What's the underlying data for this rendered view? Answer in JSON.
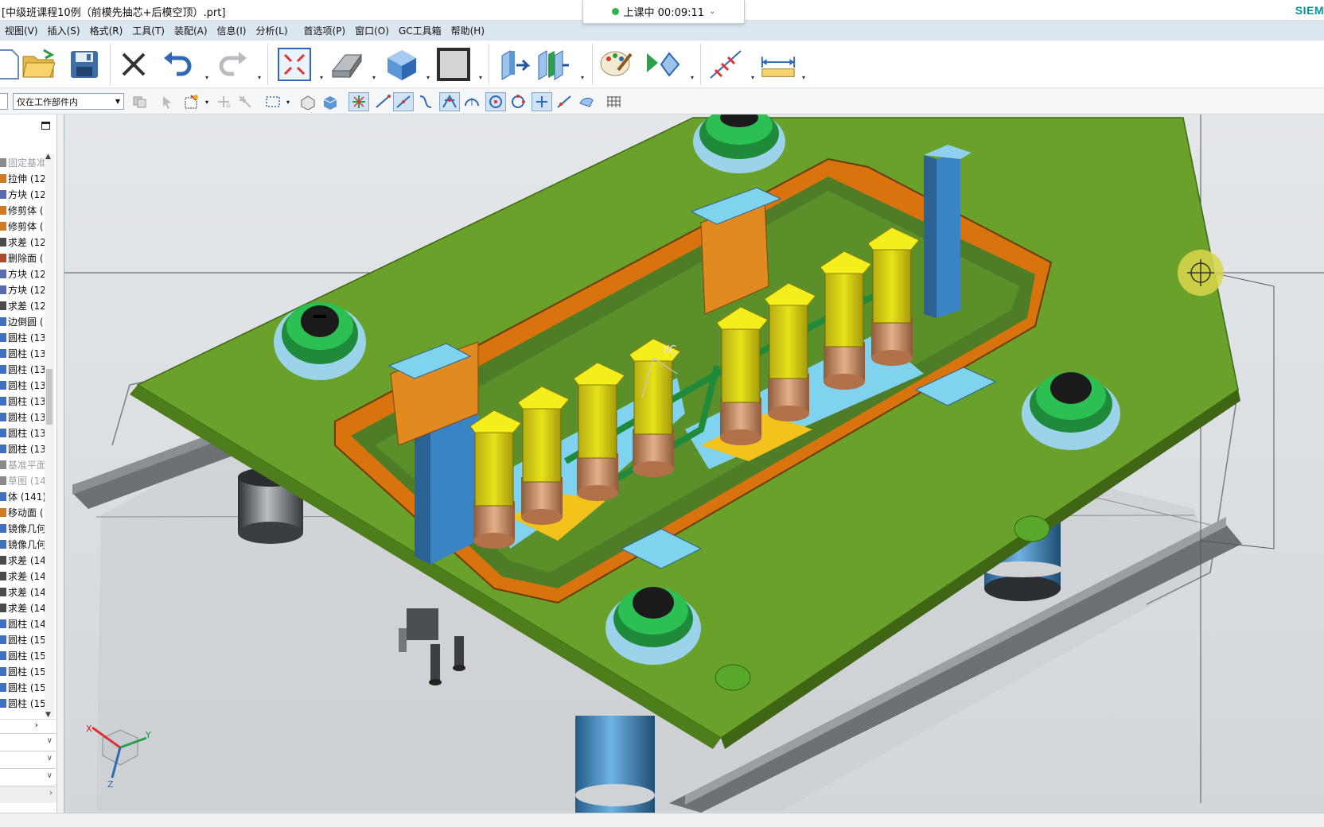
{
  "window": {
    "title": "[中级班课程10例（前模先抽芯+后模空顶）.prt]",
    "brand": "SIEM"
  },
  "timer": {
    "label": "上课中 00:09:11"
  },
  "menu": [
    "视图(V)",
    "插入(S)",
    "格式(R)",
    "工具(T)",
    "装配(A)",
    "信息(I)",
    "分析(L)",
    "首选项(P)",
    "窗口(O)",
    "GC工具箱",
    "帮助(H)"
  ],
  "selection_filter": {
    "value": "仅在工作部件内"
  },
  "navigator": {
    "items": [
      {
        "label": "固定基准",
        "dim": true,
        "color": "#8a8a8a"
      },
      {
        "label": "拉伸 (12",
        "color": "#d27a1e"
      },
      {
        "label": "方块 (12",
        "color": "#5a6ab0"
      },
      {
        "label": "修剪体 (",
        "color": "#d27a1e"
      },
      {
        "label": "修剪体 (",
        "color": "#d27a1e"
      },
      {
        "label": "求差 (12",
        "color": "#4a4a4a"
      },
      {
        "label": "删除面 (",
        "color": "#b04a2a"
      },
      {
        "label": "方块 (12",
        "color": "#5a6ab0"
      },
      {
        "label": "方块 (12",
        "color": "#5a6ab0"
      },
      {
        "label": "求差 (12",
        "color": "#4a4a4a"
      },
      {
        "label": "边倒圆 (",
        "color": "#3f6fbf"
      },
      {
        "label": "圆柱 (13",
        "color": "#3f6fbf"
      },
      {
        "label": "圆柱 (13",
        "color": "#3f6fbf"
      },
      {
        "label": "圆柱 (13",
        "color": "#3f6fbf"
      },
      {
        "label": "圆柱 (13",
        "color": "#3f6fbf"
      },
      {
        "label": "圆柱 (13",
        "color": "#3f6fbf"
      },
      {
        "label": "圆柱 (13",
        "color": "#3f6fbf"
      },
      {
        "label": "圆柱 (13",
        "color": "#3f6fbf"
      },
      {
        "label": "圆柱 (13",
        "color": "#3f6fbf"
      },
      {
        "label": "基准平面",
        "dim": true,
        "color": "#8a8a8a"
      },
      {
        "label": "草图 (14",
        "dim": true,
        "color": "#8a8a8a"
      },
      {
        "label": "体 (141)",
        "color": "#3f6fbf"
      },
      {
        "label": "移动面 (",
        "color": "#d27a1e"
      },
      {
        "label": "镜像几何",
        "color": "#3f6fbf"
      },
      {
        "label": "镜像几何",
        "color": "#3f6fbf"
      },
      {
        "label": "求差 (14",
        "color": "#4a4a4a"
      },
      {
        "label": "求差 (14",
        "color": "#4a4a4a"
      },
      {
        "label": "求差 (14",
        "color": "#4a4a4a"
      },
      {
        "label": "求差 (14",
        "color": "#4a4a4a"
      },
      {
        "label": "圆柱 (14",
        "color": "#3f6fbf"
      },
      {
        "label": "圆柱 (15",
        "color": "#3f6fbf"
      },
      {
        "label": "圆柱 (15",
        "color": "#3f6fbf"
      },
      {
        "label": "圆柱 (15",
        "color": "#3f6fbf"
      },
      {
        "label": "圆柱 (15",
        "color": "#3f6fbf"
      },
      {
        "label": "圆柱 (15",
        "color": "#3f6fbf"
      }
    ]
  },
  "viewport": {
    "csys_label": "XC",
    "triad": {
      "x": "X",
      "y": "Y",
      "z": "Z"
    }
  },
  "colors": {
    "plate_green": "#6aa12a",
    "pocket_orange": "#d9730e",
    "insert_yellow": "#e8e21a",
    "slider_blue": "#3a84c6",
    "cyan": "#7fd3ee"
  }
}
